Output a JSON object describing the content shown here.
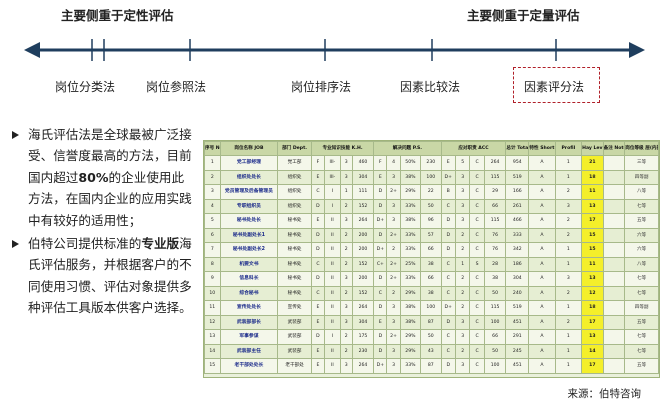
{
  "header": {
    "left_label": "主要侧重于定性评估",
    "right_label": "主要侧重于定量评估"
  },
  "methods": [
    {
      "label": "岗位分类法"
    },
    {
      "label": "岗位参照法"
    },
    {
      "label": "岗位排序法"
    },
    {
      "label": "因素比较法"
    },
    {
      "label": "因素评分法",
      "highlighted": true
    }
  ],
  "colors": {
    "axis": "#1f3e5e",
    "highlight_border": "#b0202a",
    "table_header": "#c9d7a6",
    "grade_cell": "#f4ef2a"
  },
  "bullets": [
    {
      "parts": [
        {
          "text": "海氏评估法是全球最被广泛接受、信誉度最高的方法，目前国内超过",
          "bold": false
        },
        {
          "text": "80%",
          "bold": true
        },
        {
          "text": "的企业使用此方法，在国内企业的应用实践中有较好的适用性；",
          "bold": false
        }
      ]
    },
    {
      "parts": [
        {
          "text": "伯特公司提供标准的",
          "bold": false
        },
        {
          "text": "专业版",
          "bold": true
        },
        {
          "text": "海氏评估服务，并根据客户的不同使用习惯、评估对象提供多种评估工具版本供客户选择。",
          "bold": false
        }
      ]
    }
  ],
  "table": {
    "headers": [
      "序号\nNo.",
      "岗位名称\nJOB",
      "部门\nDept.",
      "专业知识技能\nK.H.",
      "",
      "",
      "",
      "解决问题\nP.S.",
      "",
      "",
      "应对职责\nACC",
      "",
      "",
      "",
      "总计\nTota",
      "特性\nShort",
      "Profil",
      "Hay\nLev",
      "备注\nNotes",
      "岗位等级\n层(内部)"
    ],
    "rows": [
      [
        "1",
        "党工部经理",
        "党工部",
        "F",
        "III-",
        "3",
        "460",
        "F",
        "4",
        "50%",
        "230",
        "E",
        "5",
        "C",
        "264",
        "954",
        "A",
        "1",
        "21",
        "",
        "三等"
      ],
      [
        "2",
        "组织处处长",
        "组织处",
        "E",
        "III-",
        "3",
        "304",
        "E",
        "3",
        "38%",
        "100",
        "D+",
        "3",
        "C",
        "115",
        "519",
        "A",
        "1",
        "18",
        "",
        "四等副"
      ],
      [
        "3",
        "党员管理及后备管理员",
        "组织处",
        "C",
        "I",
        "1",
        "111",
        "D",
        "2+",
        "29%",
        "22",
        "B",
        "3",
        "C",
        "29",
        "166",
        "A",
        "2",
        "11",
        "",
        "八等"
      ],
      [
        "4",
        "专职组织员",
        "组织处",
        "D",
        "I",
        "2",
        "152",
        "D",
        "3",
        "33%",
        "50",
        "C",
        "3",
        "C",
        "66",
        "261",
        "A",
        "3",
        "13",
        "",
        "七等"
      ],
      [
        "5",
        "秘书处处长",
        "秘书处",
        "E",
        "II",
        "3",
        "264",
        "D+",
        "3",
        "38%",
        "96",
        "D",
        "3",
        "C",
        "115",
        "466",
        "A",
        "2",
        "17",
        "",
        "五等"
      ],
      [
        "6",
        "秘书处副处长1",
        "秘书处",
        "D",
        "II",
        "2",
        "200",
        "D",
        "2+",
        "33%",
        "57",
        "D",
        "2",
        "C",
        "76",
        "333",
        "A",
        "2",
        "15",
        "",
        "六等"
      ],
      [
        "7",
        "秘书处副处长2",
        "秘书处",
        "D",
        "II",
        "2",
        "200",
        "D+",
        "2",
        "33%",
        "66",
        "D",
        "2",
        "C",
        "76",
        "342",
        "A",
        "1",
        "15",
        "",
        "六等"
      ],
      [
        "8",
        "机要文书",
        "秘书处",
        "C",
        "II",
        "2",
        "152",
        "C+",
        "2+",
        "25%",
        "38",
        "C",
        "1",
        "S",
        "28",
        "186",
        "A",
        "1",
        "11",
        "",
        "八等"
      ],
      [
        "9",
        "信息科长",
        "秘书处",
        "D",
        "II",
        "3",
        "200",
        "D",
        "2+",
        "33%",
        "66",
        "C",
        "2",
        "C",
        "38",
        "304",
        "A",
        "3",
        "13",
        "",
        "七等"
      ],
      [
        "10",
        "综合秘书",
        "秘书处",
        "C",
        "II",
        "2",
        "152",
        "C",
        "2",
        "29%",
        "38",
        "C",
        "2",
        "C",
        "50",
        "240",
        "A",
        "2",
        "12",
        "",
        "七等"
      ],
      [
        "11",
        "宣传处处长",
        "宣传处",
        "E",
        "II",
        "3",
        "264",
        "D",
        "3",
        "38%",
        "100",
        "D+",
        "2",
        "C",
        "115",
        "519",
        "A",
        "1",
        "18",
        "",
        "四等副"
      ],
      [
        "12",
        "武装部部长",
        "武装部",
        "E",
        "II",
        "3",
        "304",
        "E",
        "3",
        "38%",
        "87",
        "D",
        "3",
        "C",
        "100",
        "451",
        "A",
        "2",
        "17",
        "",
        "五等"
      ],
      [
        "13",
        "军事参谋",
        "武装部",
        "D",
        "I",
        "2",
        "175",
        "D",
        "2+",
        "29%",
        "50",
        "C",
        "3",
        "C",
        "66",
        "291",
        "A",
        "1",
        "13",
        "",
        "七等"
      ],
      [
        "14",
        "武装部主任",
        "武装部",
        "E",
        "II",
        "2",
        "230",
        "D",
        "3",
        "29%",
        "43",
        "C",
        "2",
        "C",
        "50",
        "245",
        "A",
        "1",
        "14",
        "",
        "七等"
      ],
      [
        "15",
        "老干部处处长",
        "老干部处",
        "E",
        "II",
        "3",
        "264",
        "D+",
        "3",
        "33%",
        "87",
        "D",
        "3",
        "C",
        "100",
        "451",
        "A",
        "1",
        "17",
        "",
        "五等"
      ]
    ]
  },
  "source": "来源：伯特咨询"
}
